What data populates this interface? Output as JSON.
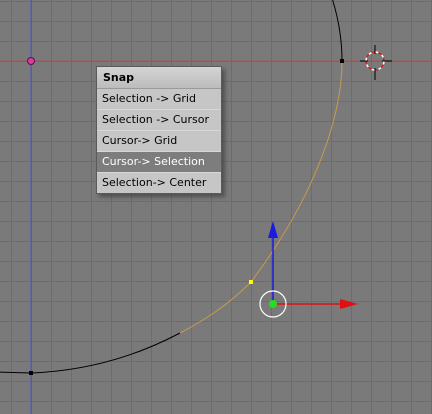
{
  "viewport": {
    "background_color": "#7a7a7a",
    "grid_color": "#6c6c6c",
    "x_axis_color": "#b05050",
    "y_axis_color": "#5050c0",
    "curve_color": "#000000",
    "selected_curve_color": "#c89a50"
  },
  "snap_menu": {
    "title": "Snap",
    "items": [
      {
        "label": "Selection -> Grid",
        "active": false
      },
      {
        "label": "Selection -> Cursor",
        "active": false
      },
      {
        "label": "Cursor-> Grid",
        "active": false
      },
      {
        "label": "Cursor-> Selection",
        "active": true
      },
      {
        "label": "Selection-> Center",
        "active": false
      }
    ]
  },
  "manipulator": {
    "x_color": "#e01010",
    "y_color": "#1a1ae0",
    "center_color": "#20e020"
  },
  "icons": [
    "3d-cursor-icon",
    "transform-manipulator-icon",
    "selected-vertex-icon"
  ]
}
